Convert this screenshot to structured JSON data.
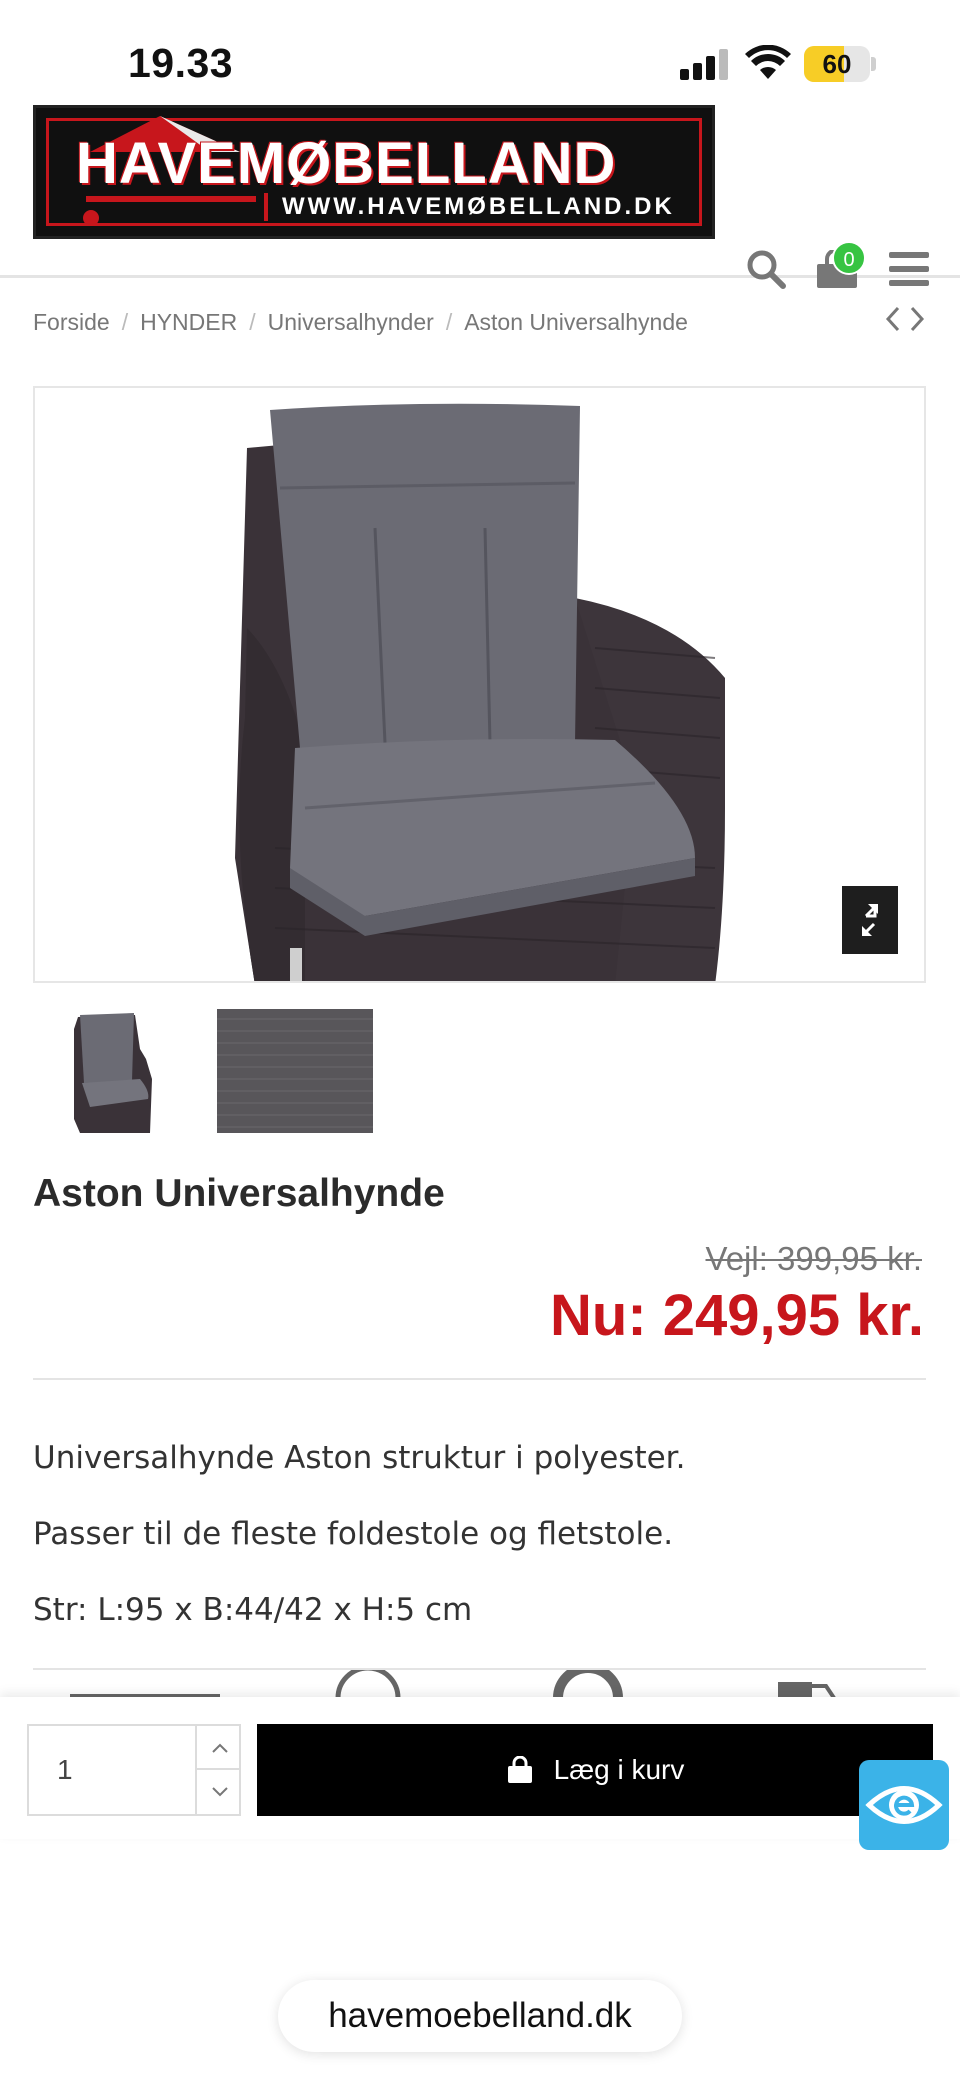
{
  "status_bar": {
    "time": "19.33",
    "battery": "60"
  },
  "header": {
    "logo_text": "HAVEMØBELLAND",
    "logo_url": "WWW.HAVEMØBELLAND.DK",
    "cart_count": "0",
    "icons": [
      "search-icon",
      "cart-icon",
      "menu-icon"
    ]
  },
  "breadcrumb": {
    "items": [
      "Forside",
      "HYNDER",
      "Universalhynder",
      "Aston Universalhynde"
    ],
    "separator": "/"
  },
  "product": {
    "title": "Aston Universalhynde",
    "old_price": "Vejl: 399,95 kr.",
    "new_price": "Nu: 249,95 kr.",
    "description": [
      "Universalhynde Aston struktur i polyester.",
      "Passer til de fleste foldestole og fletstole.",
      "Str: L:95 x B:44/42 x H:5 cm"
    ]
  },
  "cart_bar": {
    "quantity": "1",
    "add_label": "Læg i kurv"
  },
  "browser": {
    "url": "havemoebelland.dk"
  },
  "colors": {
    "accent_red": "#c7161c",
    "cart_badge": "#37c442",
    "e_badge": "#3bb3e8"
  }
}
